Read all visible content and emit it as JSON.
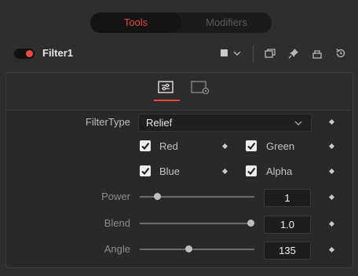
{
  "tabs": {
    "active": "Tools",
    "inactive": "Modifiers"
  },
  "node": {
    "name": "Filter1"
  },
  "controls": {
    "filter_type": {
      "label": "FilterType",
      "value": "Relief"
    },
    "channels": [
      {
        "label": "Red",
        "checked": true
      },
      {
        "label": "Green",
        "checked": true
      },
      {
        "label": "Blue",
        "checked": true
      },
      {
        "label": "Alpha",
        "checked": true
      }
    ],
    "power": {
      "label": "Power",
      "value": "1",
      "level": 0.13
    },
    "blend": {
      "label": "Blend",
      "value": "1.0",
      "level": 1.0
    },
    "angle": {
      "label": "Angle",
      "value": "135",
      "level": 0.42
    }
  },
  "colors": {
    "accent": "#e0493e",
    "background": "#2e2e2e",
    "panel": "#292929"
  },
  "icons": [
    "enable-toggle-icon",
    "color-swatch-icon",
    "chevron-down-icon",
    "version-icon",
    "pin-icon",
    "lock-icon",
    "reset-icon",
    "controls-tab-icon",
    "settings-tab-icon",
    "keyframe-diamond-icon"
  ]
}
